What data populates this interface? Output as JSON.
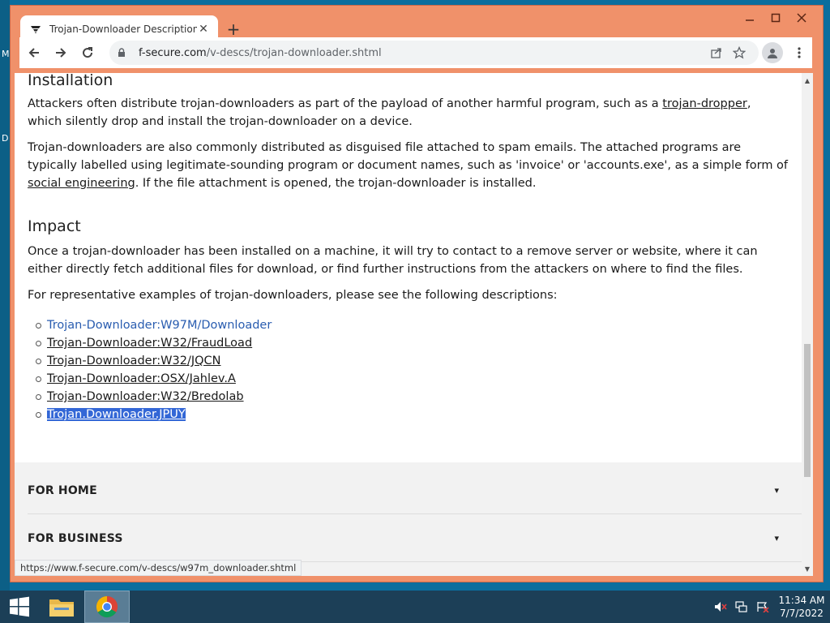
{
  "desktop": {
    "letters": [
      "M",
      "D"
    ]
  },
  "browser": {
    "tab_title": "Trojan-Downloader Description | F",
    "url_host": "f-secure.com",
    "url_path": "/v-descs/trojan-downloader.shtml",
    "status_url": "https://www.f-secure.com/v-descs/w97m_downloader.shtml"
  },
  "page": {
    "installation_heading": "Installation",
    "p1_before": "Attackers often distribute trojan-downloaders as part of the payload of another harmful program, such as a ",
    "p1_link": "trojan-dropper",
    "p1_after": ", which silently drop and install the trojan-downloader on a device.",
    "p2_before": "Trojan-downloaders are also commonly distributed as disguised file attached to spam emails. The attached programs are typically labelled using legitimate-sounding program or document names, such as 'invoice' or 'accounts.exe', as a simple form of ",
    "p2_link": "social engineering",
    "p2_after": ". If the file attachment is opened, the trojan-downloader is installed.",
    "impact_heading": "Impact",
    "p3": "Once a trojan-downloader has been installed on a machine, it will try to contact to a remove server or website, where it can either directly fetch additional files for download, or find further instructions from the attackers on where to find the files.",
    "p4": "For representative examples of trojan-downloaders, please see the following descriptions:",
    "examples": [
      "Trojan-Downloader:W97M/Downloader",
      "Trojan-Downloader:W32/FraudLoad",
      "Trojan-Downloader:W32/JQCN",
      "Trojan-Downloader:OSX/Jahlev.A",
      "Trojan-Downloader:W32/Bredolab",
      "Trojan.Downloader.JPUY"
    ],
    "footer_home": "FOR HOME",
    "footer_business": "FOR BUSINESS"
  },
  "taskbar": {
    "time": "11:34 AM",
    "date": "7/7/2022"
  },
  "colors": {
    "window_frame": "#f0916a",
    "link_blue": "#2a5db0",
    "selection": "#3367d6",
    "taskbar": "#1c3f57"
  }
}
